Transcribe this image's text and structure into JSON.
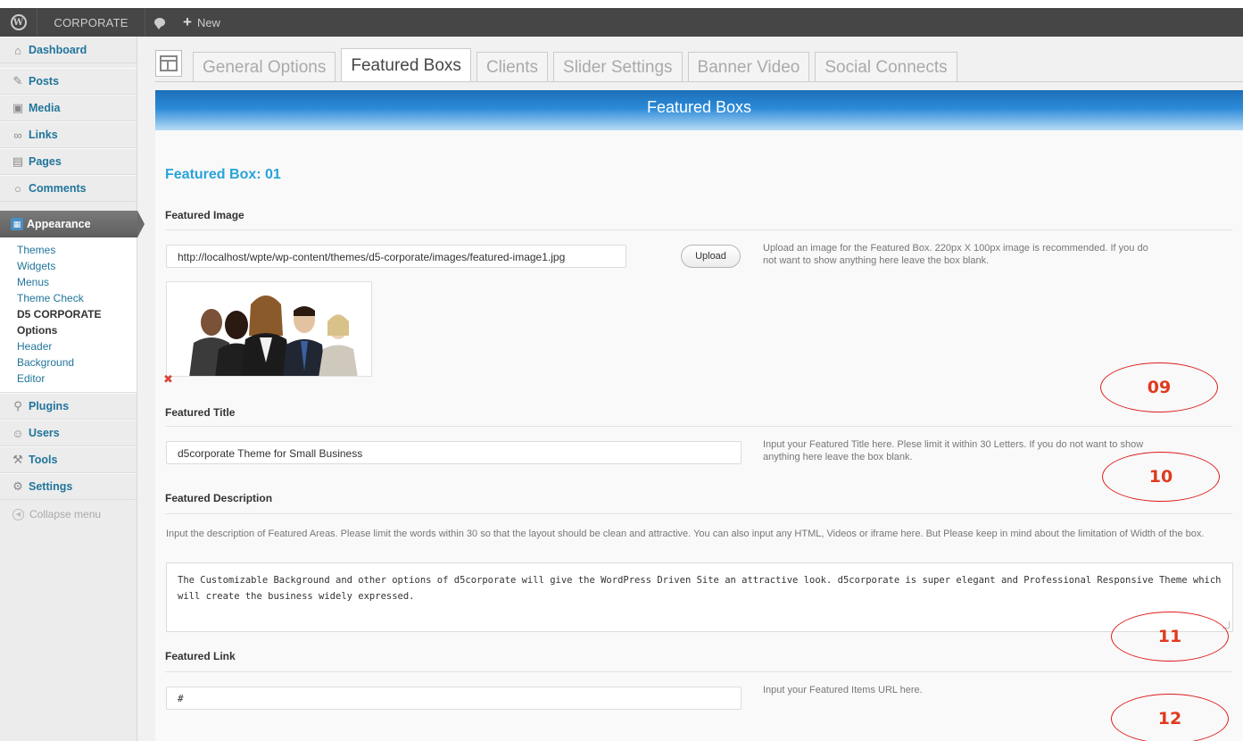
{
  "adminbar": {
    "site_name": "CORPORATE",
    "new_label": "New"
  },
  "sidebar": {
    "items_top": [
      {
        "label": "Dashboard",
        "icon": "house-icon"
      },
      {
        "label": "Posts",
        "icon": "pin-icon"
      },
      {
        "label": "Media",
        "icon": "media-icon"
      },
      {
        "label": "Links",
        "icon": "link-icon"
      },
      {
        "label": "Pages",
        "icon": "pages-icon"
      },
      {
        "label": "Comments",
        "icon": "comment-icon"
      }
    ],
    "active": {
      "label": "Appearance",
      "icon": "appearance-icon"
    },
    "submenu": [
      "Themes",
      "Widgets",
      "Menus",
      "Theme Check",
      "D5 CORPORATE",
      "Options",
      "Header",
      "Background",
      "Editor"
    ],
    "items_bottom": [
      {
        "label": "Plugins",
        "icon": "plug-icon"
      },
      {
        "label": "Users",
        "icon": "users-icon"
      },
      {
        "label": "Tools",
        "icon": "tools-icon"
      },
      {
        "label": "Settings",
        "icon": "settings-icon"
      }
    ],
    "collapse_label": "Collapse menu"
  },
  "tabs": [
    {
      "label": "General Options",
      "active": false
    },
    {
      "label": "Featured Boxs",
      "active": true
    },
    {
      "label": "Clients",
      "active": false
    },
    {
      "label": "Slider Settings",
      "active": false
    },
    {
      "label": "Banner Video",
      "active": false
    },
    {
      "label": "Social Connects",
      "active": false
    }
  ],
  "panel": {
    "header": "Featured Boxs",
    "box_title": "Featured Box: 01",
    "image": {
      "label": "Featured Image",
      "value": "http://localhost/wpte/wp-content/themes/d5-corporate/images/featured-image1.jpg",
      "upload_label": "Upload",
      "help": "Upload an image for the Featured Box. 220px X 100px image is recommended. If you do not want to show anything here leave the box blank."
    },
    "title": {
      "label": "Featured Title",
      "value": "d5corporate Theme for Small Business",
      "help": "Input your Featured Title here. Plese limit it within 30 Letters. If you do not want to show anything here leave the box blank."
    },
    "description": {
      "label": "Featured Description",
      "help": "Input the description of Featured Areas. Please limit the words within 30 so that the layout should be clean and attractive. You can also input any HTML, Videos or iframe here. But Please keep in mind about the limitation of Width of the box.",
      "value": "The Customizable Background and other options of d5corporate will give the WordPress Driven Site an attractive look.  d5corporate is super elegant and Professional Responsive Theme which will create the business widely expressed."
    },
    "link": {
      "label": "Featured Link",
      "value": "#",
      "help": "Input your Featured Items URL here."
    }
  },
  "annotations": [
    "09",
    "10",
    "11",
    "12"
  ],
  "colors": {
    "accent": "#29a3d8",
    "link": "#21759b",
    "annotation": "#e01b1b",
    "header_blue": "#1d6fb8"
  }
}
